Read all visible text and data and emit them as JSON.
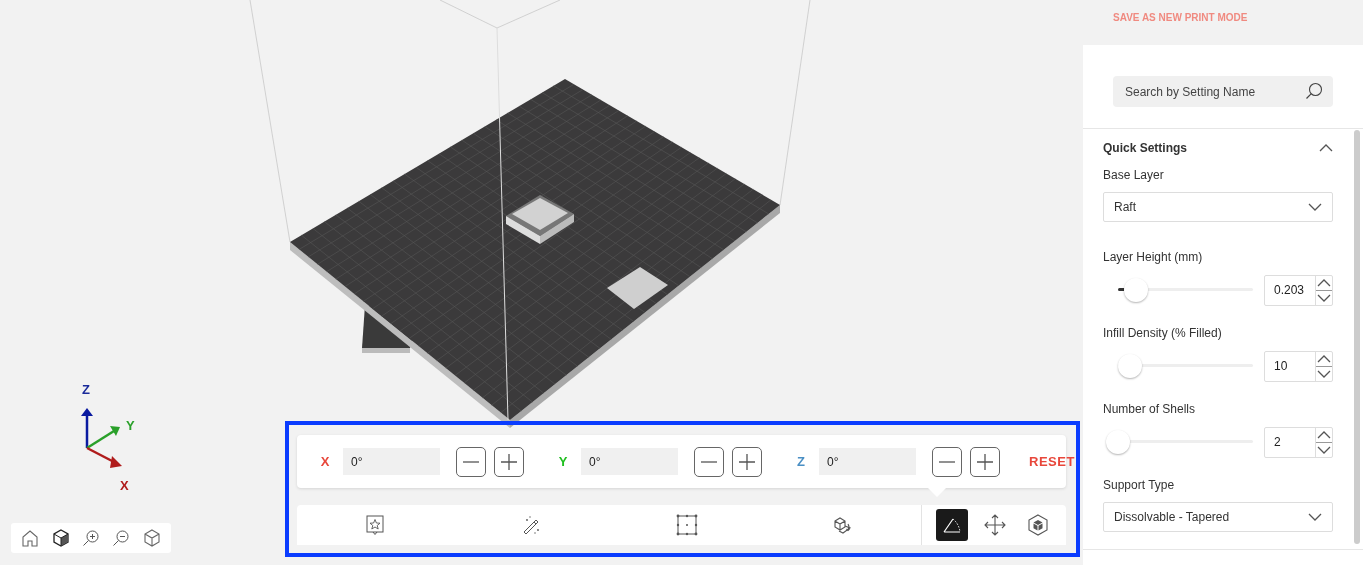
{
  "viewport": {
    "axes": [
      {
        "label": "Z",
        "color": "#1a2a9a"
      },
      {
        "label": "Y",
        "color": "#2aa02a"
      },
      {
        "label": "X",
        "color": "#b01c1c"
      }
    ]
  },
  "rotation": {
    "axes": [
      {
        "label": "X",
        "color": "#e8473b",
        "value": "0°"
      },
      {
        "label": "Y",
        "color": "#1fbf1f",
        "value": "0°"
      },
      {
        "label": "Z",
        "color": "#4a8fc4",
        "value": "0°"
      }
    ],
    "reset": "RESET"
  },
  "tools": [
    {
      "kind": "favorite",
      "selected": false
    },
    {
      "kind": "magic",
      "selected": false
    },
    {
      "kind": "bounds",
      "selected": false
    },
    {
      "kind": "orient",
      "selected": false
    },
    {
      "kind": "rotate",
      "selected": true
    },
    {
      "kind": "move",
      "selected": false
    },
    {
      "kind": "scale",
      "selected": false
    }
  ],
  "panel": {
    "save_link": "SAVE AS NEW PRINT MODE",
    "search": {
      "placeholder": "Search by Setting Name"
    },
    "section": {
      "title": "Quick Settings",
      "expanded": true,
      "settings": [
        {
          "kind": "dropdown",
          "label": "Base Layer",
          "value": "Raft"
        },
        {
          "kind": "slider",
          "label": "Layer Height (mm)",
          "level": 0.15,
          "value": "0.203"
        },
        {
          "kind": "slider",
          "label": "Infill Density (% Filled)",
          "level": 0.1,
          "value": "10"
        },
        {
          "kind": "slider",
          "label": "Number of Shells",
          "level": 0,
          "value": "2"
        },
        {
          "kind": "dropdown",
          "label": "Support Type",
          "value": "Dissolvable - Tapered"
        }
      ]
    }
  }
}
